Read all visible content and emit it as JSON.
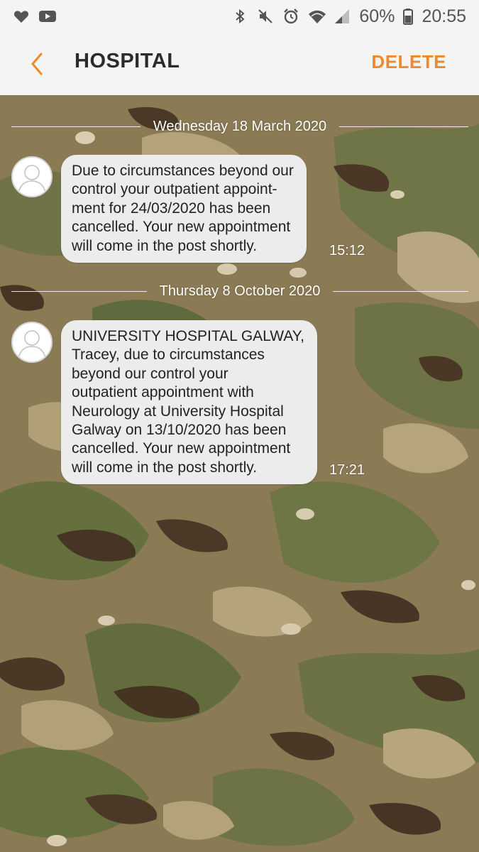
{
  "status_bar": {
    "battery_percent": "60%",
    "time": "20:55",
    "left_icons": [
      "heart-icon",
      "youtube-icon"
    ],
    "right_icons": [
      "bluetooth-icon",
      "mute-icon",
      "alarm-icon",
      "wifi-icon",
      "signal-icon",
      "battery-icon"
    ]
  },
  "header": {
    "title": "HOSPITAL",
    "delete_label": "DELETE",
    "accent_color": "#f0892a"
  },
  "conversation": {
    "messages": [
      {
        "date": "Wednesday 18 March 2020",
        "lines": [
          "Due to circumstances beyond our",
          "control your outpatient appoint-",
          "ment for 24/03/2020 has been",
          "cancelled. Your new appointment",
          "will come in the post shortly."
        ],
        "time": "15:12"
      },
      {
        "date": "Thursday 8 October 2020",
        "lines": [
          "UNIVERSITY HOSPITAL GALWAY,",
          "Tracey, due to circumstances",
          "beyond our control your",
          "outpatient appointment with",
          "Neurology at University Hospital",
          "Galway on 13/10/2020 has been",
          "cancelled. Your new appointment",
          "will come in the post shortly."
        ],
        "time": "17:21"
      }
    ]
  }
}
